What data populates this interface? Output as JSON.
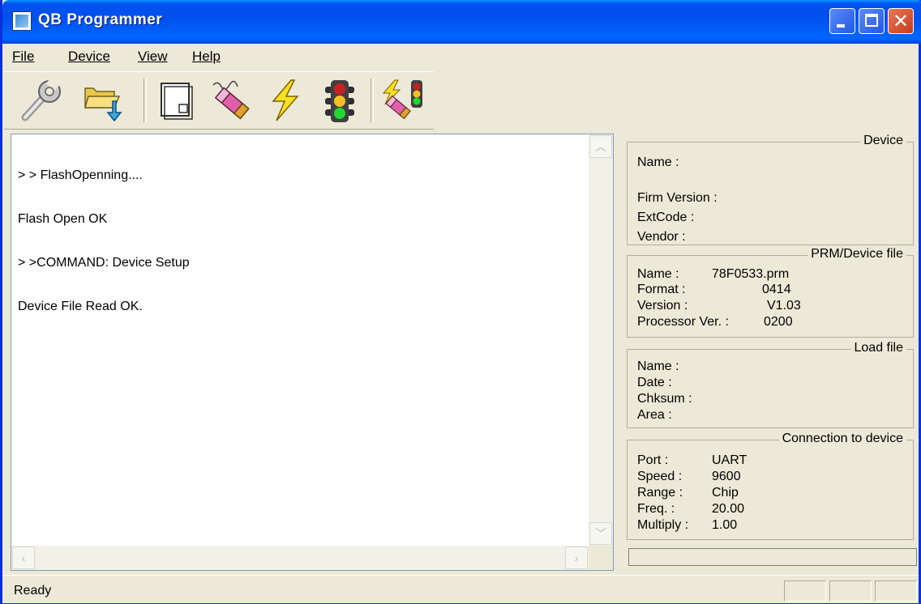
{
  "window": {
    "title": "QB Programmer"
  },
  "menu": {
    "items": [
      "File",
      "Device",
      "View",
      "Help"
    ]
  },
  "toolbar": {
    "tools": [
      "wrench-icon",
      "open-folder-icon",
      "blank-page-icon",
      "eraser-icon",
      "lightning-icon",
      "traffic-light-icon",
      "auto-program-icon"
    ]
  },
  "log": {
    "lines": [
      "> > FlashOpenning....",
      "Flash Open OK",
      "> >COMMAND: Device Setup",
      "Device File Read OK."
    ]
  },
  "device": {
    "title": "Device",
    "name_label": "Name :",
    "name_value": "",
    "firm_label": "Firm Version :",
    "firm_value": "",
    "ext_label": "ExtCode :",
    "ext_value": "",
    "vendor_label": "Vendor :",
    "vendor_value": ""
  },
  "prm": {
    "title": "PRM/Device file",
    "name_label": "Name :",
    "name_value": "78F0533.prm",
    "format_label": "Format :",
    "format_value": "0414",
    "version_label": "Version :",
    "version_value": "V1.03",
    "proc_label": "Processor Ver. :",
    "proc_value": "0200"
  },
  "load": {
    "title": "Load file",
    "name_label": "Name :",
    "date_label": "Date :",
    "chksum_label": "Chksum :",
    "area_label": "Area :"
  },
  "connection": {
    "title": "Connection to device",
    "port_label": "Port :",
    "port_value": "UART",
    "speed_label": "Speed :",
    "speed_value": "9600",
    "range_label": "Range :",
    "range_value": "Chip",
    "freq_label": "Freq. :",
    "freq_value": "20.00",
    "multiply_label": "Multiply :",
    "multiply_value": "1.00"
  },
  "status": {
    "text": "Ready"
  },
  "colors": {
    "titlebar": "#0054e3",
    "face": "#ece9d8",
    "close": "#d8562e"
  }
}
